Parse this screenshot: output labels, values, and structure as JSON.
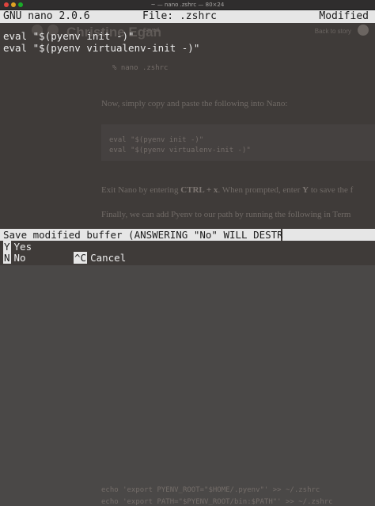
{
  "window": {
    "title": "~ — nano .zshrc — 80×24"
  },
  "nano": {
    "version": "GNU nano 2.0.6",
    "file": "File: .zshrc",
    "status": "Modified",
    "lines": [
      "eval \"$(pyenv init -)\"",
      "eval \"$(pyenv virtualenv-init -)\""
    ],
    "prompt": "Save modified buffer (ANSWERING \"No\" WILL DESTROY CHANGES) ?",
    "shortcuts": {
      "yes": {
        "key": "Y",
        "label": "Yes"
      },
      "no": {
        "key": "N",
        "label": "No"
      },
      "cancel": {
        "key": "^C",
        "label": "Cancel"
      }
    }
  },
  "background_page": {
    "author": "Christine Egan",
    "saved": "Saved",
    "back_link": "Back to story",
    "code_cmd": "% nano .zshrc",
    "para1": "Now, simply copy and paste the following into Nano:",
    "code1": "eval \"$(pyenv init -)\"",
    "code2": "eval \"$(pyenv virtualenv-init -)\"",
    "para2_start": "Exit Nano by entering ",
    "para2_key1": "CTRL + x",
    "para2_mid": ". When prompted, enter ",
    "para2_key2": "Y",
    "para2_end": " to save the f",
    "para3": "Finally, we can add Pyenv to our path by running the following in Term",
    "code3": "echo 'export PYENV_ROOT=\"$HOME/.pyenv\"' >> ~/.zshrc",
    "code4": "echo 'export PATH=\"$PYENV_ROOT/bin:$PATH\"' >> ~/.zshrc"
  }
}
